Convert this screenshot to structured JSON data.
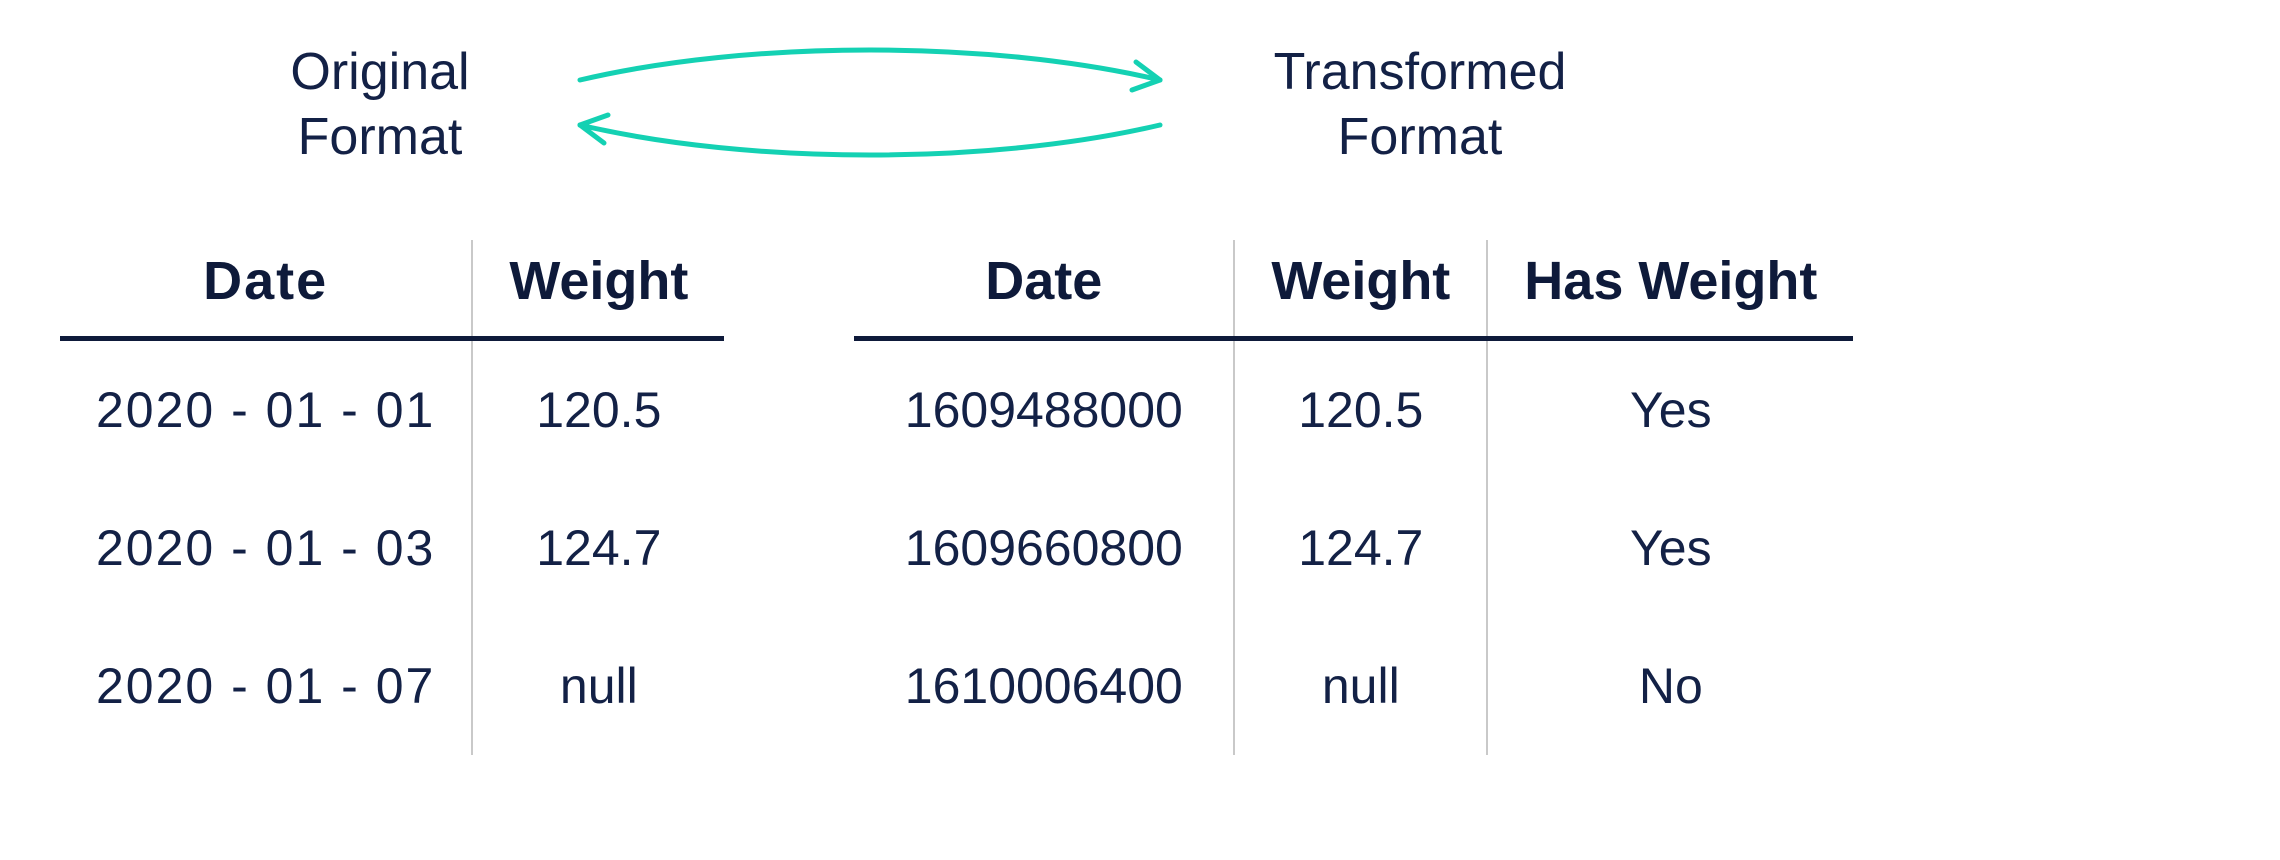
{
  "labels": {
    "original_line1": "Original",
    "original_line2": "Format",
    "transformed_line1": "Transformed",
    "transformed_line2": "Format"
  },
  "colors": {
    "arrow": "#14d1b3",
    "text": "#0e1a3a"
  },
  "original": {
    "headers": [
      "Date",
      "Weight"
    ],
    "rows": [
      {
        "date": "2020 - 01 - 01",
        "weight": "120.5"
      },
      {
        "date": "2020 - 01 - 03",
        "weight": "124.7"
      },
      {
        "date": "2020 - 01 - 07",
        "weight": "null"
      }
    ]
  },
  "transformed": {
    "headers": [
      "Date",
      "Weight",
      "Has Weight"
    ],
    "rows": [
      {
        "date": "1609488000",
        "weight": "120.5",
        "has_weight": "Yes"
      },
      {
        "date": "1609660800",
        "weight": "124.7",
        "has_weight": "Yes"
      },
      {
        "date": "1610006400",
        "weight": "null",
        "has_weight": "No"
      }
    ]
  }
}
